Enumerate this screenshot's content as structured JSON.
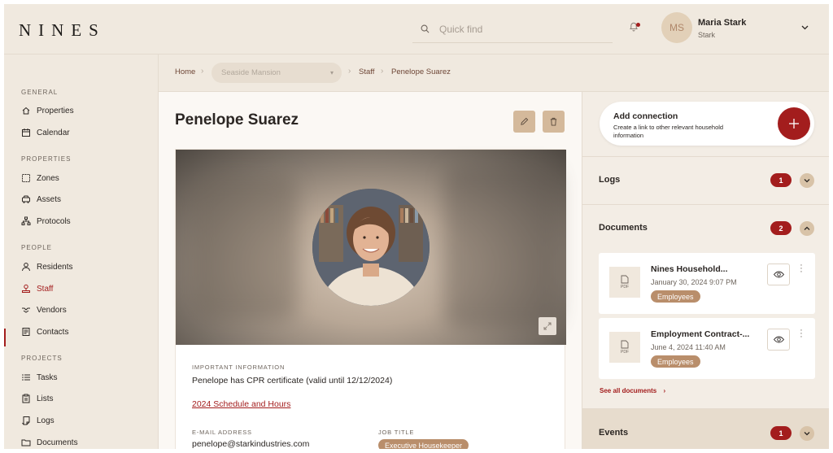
{
  "app": {
    "logo": "NINES"
  },
  "header": {
    "search_placeholder": "Quick find",
    "user": {
      "initials": "MS",
      "name": "Maria Stark",
      "org": "Stark"
    }
  },
  "sidebar": {
    "sections": [
      {
        "title": "GENERAL",
        "items": [
          {
            "label": "Properties",
            "icon": "home-icon"
          },
          {
            "label": "Calendar",
            "icon": "calendar-icon"
          }
        ]
      },
      {
        "title": "PROPERTIES",
        "items": [
          {
            "label": "Zones",
            "icon": "zones-icon"
          },
          {
            "label": "Assets",
            "icon": "car-icon"
          },
          {
            "label": "Protocols",
            "icon": "hierarchy-icon"
          }
        ]
      },
      {
        "title": "PEOPLE",
        "items": [
          {
            "label": "Residents",
            "icon": "person-icon"
          },
          {
            "label": "Staff",
            "icon": "staff-icon"
          },
          {
            "label": "Vendors",
            "icon": "handshake-icon"
          },
          {
            "label": "Contacts",
            "icon": "contacts-icon"
          }
        ]
      },
      {
        "title": "PROJECTS",
        "items": [
          {
            "label": "Tasks",
            "icon": "list-icon"
          },
          {
            "label": "Lists",
            "icon": "clipboard-icon"
          },
          {
            "label": "Logs",
            "icon": "log-icon"
          },
          {
            "label": "Documents",
            "icon": "folder-icon"
          }
        ]
      }
    ],
    "active": "Staff"
  },
  "breadcrumb": {
    "home": "Home",
    "property_select": "Seaside Mansion",
    "section": "Staff",
    "current": "Penelope Suarez"
  },
  "profile": {
    "name": "Penelope Suarez",
    "important_label": "IMPORTANT INFORMATION",
    "important_value": "Penelope has CPR certificate (valid until 12/12/2024)",
    "schedule_link": "2024 Schedule and Hours",
    "email_label": "E-MAIL ADDRESS",
    "email_value": "penelope@starkindustries.com",
    "job_label": "JOB TITLE",
    "job_value": "Executive Housekeeper"
  },
  "right_panel": {
    "add_connection": {
      "title": "Add connection",
      "description": "Create a link to other relevant household information"
    },
    "logs": {
      "title": "Logs",
      "count": "1"
    },
    "documents": {
      "title": "Documents",
      "count": "2",
      "items": [
        {
          "name": "Nines Household...",
          "date": "January 30, 2024 9:07 PM",
          "tag": "Employees",
          "type": "PDF"
        },
        {
          "name": "Employment Contract-...",
          "date": "June 4, 2024 11:40 AM",
          "tag": "Employees",
          "type": "PDF"
        }
      ],
      "see_all": "See all documents"
    },
    "events": {
      "title": "Events",
      "count": "1"
    }
  },
  "colors": {
    "accent": "#a31d1d",
    "background": "#f0e9df",
    "tag": "#b98e6b",
    "button": "#d4b99b"
  }
}
